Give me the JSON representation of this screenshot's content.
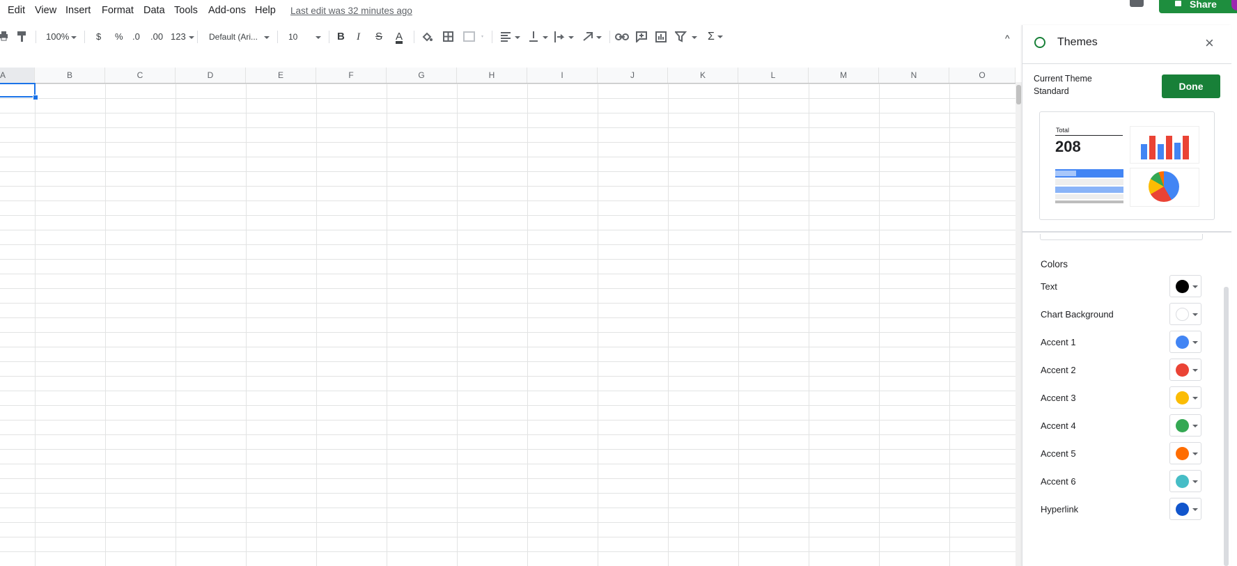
{
  "menu": {
    "items": [
      "Edit",
      "View",
      "Insert",
      "Format",
      "Data",
      "Tools",
      "Add-ons",
      "Help"
    ],
    "last_edit": "Last edit was 32 minutes ago"
  },
  "header": {
    "share_label": "Share"
  },
  "toolbar": {
    "zoom": "100%",
    "currency": "$",
    "percent": "%",
    "decrease_decimal": ".0",
    "increase_decimal": ".00",
    "more_formats": "123",
    "font": "Default (Ari...",
    "font_size": "10",
    "bold": "B",
    "italic": "I",
    "strike": "S",
    "text_color": "A",
    "sum": "Σ",
    "collapse": "^"
  },
  "sheet": {
    "columns": [
      "A",
      "B",
      "C",
      "D",
      "E",
      "F",
      "G",
      "H",
      "I",
      "J",
      "K",
      "L",
      "M",
      "N",
      "O"
    ]
  },
  "themes_panel": {
    "title": "Themes",
    "current_theme_label": "Current Theme",
    "current_theme_value": "Standard",
    "done_label": "Done",
    "preview": {
      "total_label": "Total",
      "total_value": "208"
    },
    "colors_title": "Colors",
    "colors": [
      {
        "label": "Text",
        "hex": "#000000"
      },
      {
        "label": "Chart Background",
        "hex": "#ffffff"
      },
      {
        "label": "Accent 1",
        "hex": "#4285f4"
      },
      {
        "label": "Accent 2",
        "hex": "#ea4335"
      },
      {
        "label": "Accent 3",
        "hex": "#fbbc04"
      },
      {
        "label": "Accent 4",
        "hex": "#34a853"
      },
      {
        "label": "Accent 5",
        "hex": "#ff6d01"
      },
      {
        "label": "Accent 6",
        "hex": "#46bdc6"
      },
      {
        "label": "Hyperlink",
        "hex": "#1155cc"
      }
    ]
  }
}
